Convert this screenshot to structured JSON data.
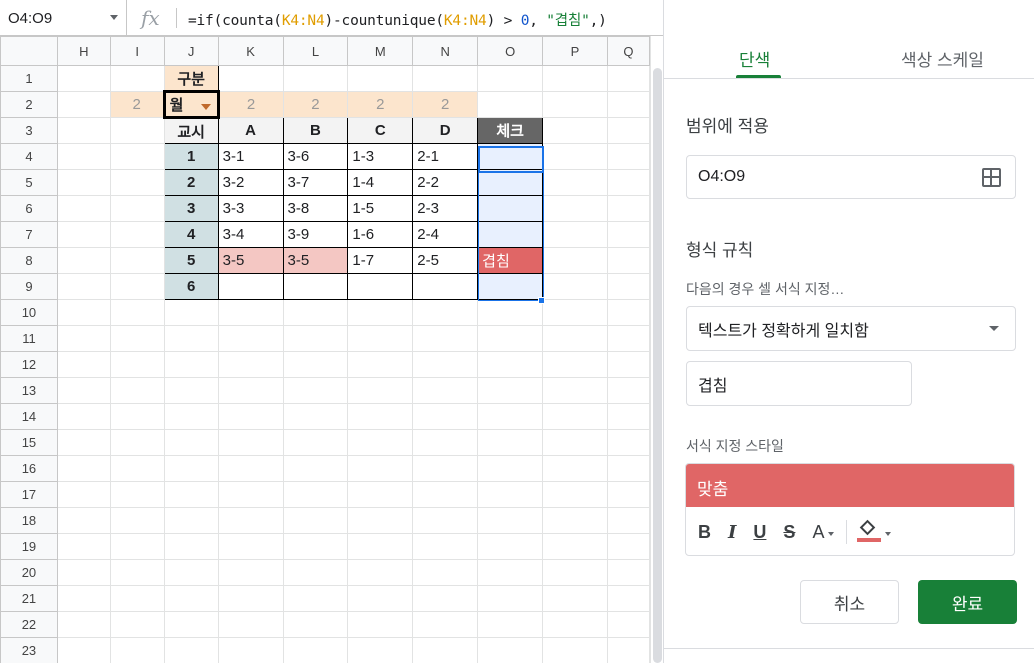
{
  "formula_bar": {
    "name_box": "O4:O9",
    "fx": "fx",
    "formula_parts": [
      "=if(counta(",
      "K4:N4",
      ")-countunique(",
      "K4:N4",
      ") > ",
      "0",
      ", ",
      "\"겹침\"",
      ",)"
    ]
  },
  "grid": {
    "columns": [
      "H",
      "I",
      "J",
      "K",
      "L",
      "M",
      "N",
      "O",
      "P",
      "Q"
    ],
    "rows": [
      "1",
      "2",
      "3",
      "4",
      "5",
      "6",
      "7",
      "8",
      "9",
      "10",
      "11",
      "12",
      "13",
      "14",
      "15",
      "16",
      "17",
      "18",
      "19",
      "20",
      "21",
      "22",
      "23"
    ],
    "gubun_label": "구분",
    "dropdown_value": "월",
    "row2_values": [
      "2",
      "2",
      "2",
      "2",
      "2"
    ],
    "header": {
      "period": "교시",
      "a": "A",
      "b": "B",
      "c": "C",
      "d": "D",
      "check": "체크"
    },
    "periods": [
      "1",
      "2",
      "3",
      "4",
      "5",
      "6"
    ],
    "table": [
      [
        "3-1",
        "3-6",
        "1-3",
        "2-1",
        ""
      ],
      [
        "3-2",
        "3-7",
        "1-4",
        "2-2",
        ""
      ],
      [
        "3-3",
        "3-8",
        "1-5",
        "2-3",
        ""
      ],
      [
        "3-4",
        "3-9",
        "1-6",
        "2-4",
        ""
      ],
      [
        "3-5",
        "3-5",
        "1-7",
        "2-5",
        "겹침"
      ],
      [
        "",
        "",
        "",
        "",
        ""
      ]
    ]
  },
  "panel": {
    "tabs": [
      "단색",
      "색상 스케일"
    ],
    "apply_range_label": "범위에 적용",
    "range_value": "O4:O9",
    "rules_label": "형식 규칙",
    "condition_label": "다음의 경우 셀 서식 지정…",
    "condition_value": "텍스트가 정확하게 일치함",
    "condition_input": "겹침",
    "style_label": "서식 지정 스타일",
    "style_preview": "맞춤",
    "toolbar": {
      "bold": "B",
      "italic": "I",
      "underline": "U",
      "strike": "S",
      "text_color": "A"
    },
    "cancel": "취소",
    "done": "완료"
  },
  "colors": {
    "accent": "#188038",
    "highlight_red": "#e06666",
    "light_red": "#f4c7c3",
    "peach": "#fce5cd",
    "period_blue": "#d0e0e3",
    "selection": "#1a73e8"
  }
}
